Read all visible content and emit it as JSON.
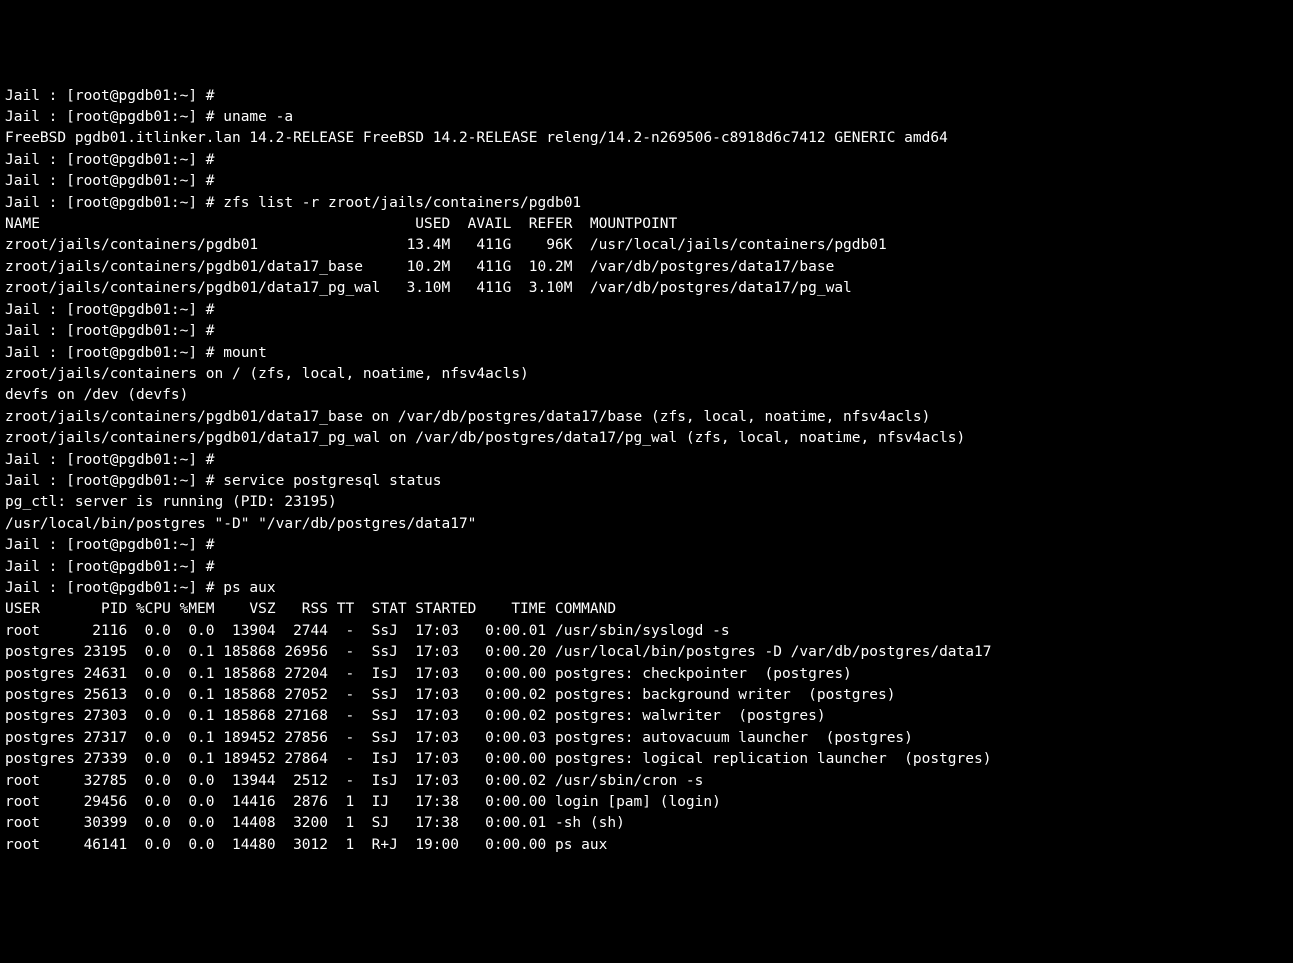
{
  "lines": [
    "Jail : [root@pgdb01:~] #",
    "Jail : [root@pgdb01:~] # uname -a",
    "FreeBSD pgdb01.itlinker.lan 14.2-RELEASE FreeBSD 14.2-RELEASE releng/14.2-n269506-c8918d6c7412 GENERIC amd64",
    "Jail : [root@pgdb01:~] #",
    "Jail : [root@pgdb01:~] #",
    "Jail : [root@pgdb01:~] # zfs list -r zroot/jails/containers/pgdb01",
    "NAME                                           USED  AVAIL  REFER  MOUNTPOINT",
    "zroot/jails/containers/pgdb01                 13.4M   411G    96K  /usr/local/jails/containers/pgdb01",
    "zroot/jails/containers/pgdb01/data17_base     10.2M   411G  10.2M  /var/db/postgres/data17/base",
    "zroot/jails/containers/pgdb01/data17_pg_wal   3.10M   411G  3.10M  /var/db/postgres/data17/pg_wal",
    "Jail : [root@pgdb01:~] #",
    "Jail : [root@pgdb01:~] #",
    "Jail : [root@pgdb01:~] # mount",
    "zroot/jails/containers on / (zfs, local, noatime, nfsv4acls)",
    "devfs on /dev (devfs)",
    "zroot/jails/containers/pgdb01/data17_base on /var/db/postgres/data17/base (zfs, local, noatime, nfsv4acls)",
    "zroot/jails/containers/pgdb01/data17_pg_wal on /var/db/postgres/data17/pg_wal (zfs, local, noatime, nfsv4acls)",
    "Jail : [root@pgdb01:~] #",
    "Jail : [root@pgdb01:~] # service postgresql status",
    "pg_ctl: server is running (PID: 23195)",
    "/usr/local/bin/postgres \"-D\" \"/var/db/postgres/data17\"",
    "Jail : [root@pgdb01:~] #",
    "Jail : [root@pgdb01:~] #",
    "Jail : [root@pgdb01:~] # ps aux",
    "USER       PID %CPU %MEM    VSZ   RSS TT  STAT STARTED    TIME COMMAND",
    "root      2116  0.0  0.0  13904  2744  -  SsJ  17:03   0:00.01 /usr/sbin/syslogd -s",
    "postgres 23195  0.0  0.1 185868 26956  -  SsJ  17:03   0:00.20 /usr/local/bin/postgres -D /var/db/postgres/data17",
    "postgres 24631  0.0  0.1 185868 27204  -  IsJ  17:03   0:00.00 postgres: checkpointer  (postgres)",
    "postgres 25613  0.0  0.1 185868 27052  -  SsJ  17:03   0:00.02 postgres: background writer  (postgres)",
    "postgres 27303  0.0  0.1 185868 27168  -  SsJ  17:03   0:00.02 postgres: walwriter  (postgres)",
    "postgres 27317  0.0  0.1 189452 27856  -  SsJ  17:03   0:00.03 postgres: autovacuum launcher  (postgres)",
    "postgres 27339  0.0  0.1 189452 27864  -  IsJ  17:03   0:00.00 postgres: logical replication launcher  (postgres)",
    "root     32785  0.0  0.0  13944  2512  -  IsJ  17:03   0:00.02 /usr/sbin/cron -s",
    "root     29456  0.0  0.0  14416  2876  1  IJ   17:38   0:00.00 login [pam] (login)",
    "root     30399  0.0  0.0  14408  3200  1  SJ   17:38   0:00.01 -sh (sh)",
    "root     46141  0.0  0.0  14480  3012  1  R+J  19:00   0:00.00 ps aux"
  ],
  "prompt_final": "Jail : [root@pgdb01:~] # "
}
